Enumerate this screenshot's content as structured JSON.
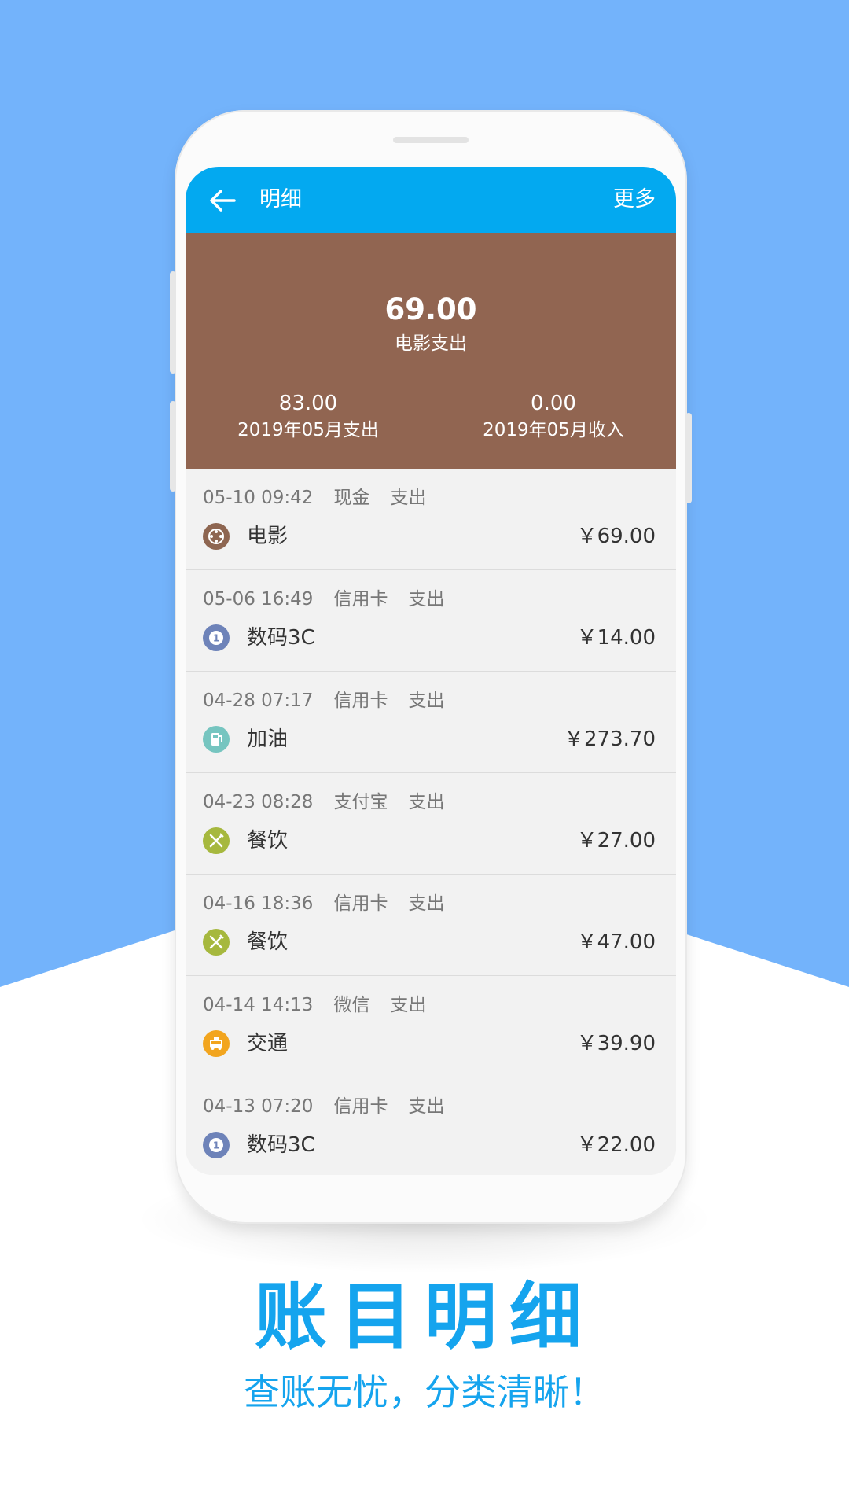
{
  "appbar": {
    "title": "明细",
    "more": "更多"
  },
  "summary": {
    "amount": "69.00",
    "label": "电影支出",
    "month_expense_value": "83.00",
    "month_expense_label": "2019年05月支出",
    "month_income_value": "0.00",
    "month_income_label": "2019年05月收入"
  },
  "transactions": [
    {
      "datetime": "05-10 09:42",
      "account": "现金",
      "type": "支出",
      "category": "电影",
      "amount": "￥69.00",
      "icon": "film-reel-icon",
      "color": "#8e6651"
    },
    {
      "datetime": "05-06 16:49",
      "account": "信用卡",
      "type": "支出",
      "category": "数码3C",
      "amount": "￥14.00",
      "icon": "digital-icon",
      "color": "#6e83b9"
    },
    {
      "datetime": "04-28 07:17",
      "account": "信用卡",
      "type": "支出",
      "category": "加油",
      "amount": "￥273.70",
      "icon": "fuel-pump-icon",
      "color": "#76c5c0"
    },
    {
      "datetime": "04-23 08:28",
      "account": "支付宝",
      "type": "支出",
      "category": "餐饮",
      "amount": "￥27.00",
      "icon": "utensils-icon",
      "color": "#a6b83e"
    },
    {
      "datetime": "04-16 18:36",
      "account": "信用卡",
      "type": "支出",
      "category": "餐饮",
      "amount": "￥47.00",
      "icon": "utensils-icon",
      "color": "#a6b83e"
    },
    {
      "datetime": "04-14 14:13",
      "account": "微信",
      "type": "支出",
      "category": "交通",
      "amount": "￥39.90",
      "icon": "taxi-icon",
      "color": "#f2a51f"
    },
    {
      "datetime": "04-13 07:20",
      "account": "信用卡",
      "type": "支出",
      "category": "数码3C",
      "amount": "￥22.00",
      "icon": "digital-icon",
      "color": "#6e83b9"
    }
  ],
  "promo": {
    "headline": "账目明细",
    "subline": "查账无忧，分类清晰！"
  },
  "colors": {
    "background_blue": "#73b3fb",
    "appbar": "#03a9f0",
    "summary_brown": "#916551",
    "accent_text": "#15a4ee"
  }
}
